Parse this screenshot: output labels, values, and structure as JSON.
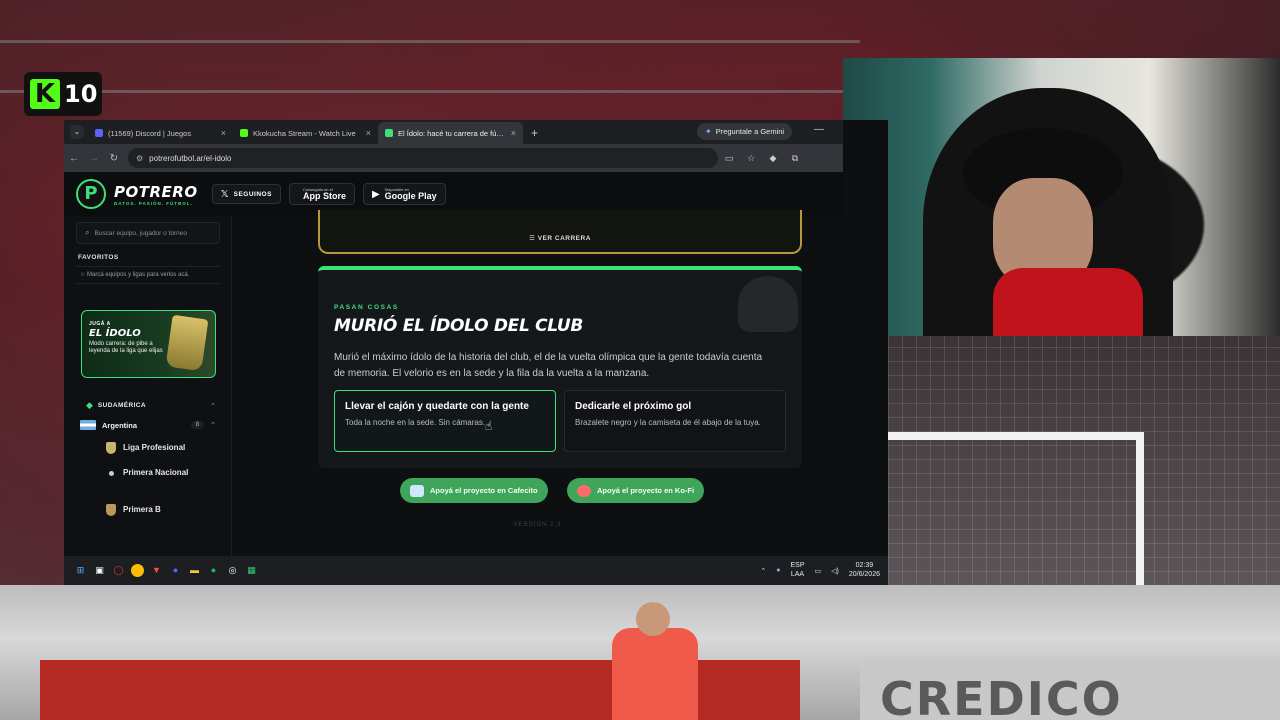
{
  "stream": {
    "viewer_count": "10",
    "ad_text": "CREDICO"
  },
  "browser": {
    "tabs": [
      {
        "label": "(11569) Discord | Juegos",
        "favicon_color": "#5865f2"
      },
      {
        "label": "Kkokucha Stream - Watch Live",
        "favicon_color": "#53fc18"
      },
      {
        "label": "El Ídolo: hacé tu carrera de fútbol",
        "favicon_color": "#3de07a",
        "active": true
      }
    ],
    "gemini_label": "Preguntale a Gemini",
    "url": "potrerofutbol.ar/el-idolo"
  },
  "site": {
    "brand_name": "POTRERO",
    "brand_tag": "DATOS. PASIÓN. FÚTBOL.",
    "follow_label": "SEGUINOS",
    "app_store_small": "Conseguilo en el",
    "app_store_big": "App Store",
    "google_play_small": "Disponible en",
    "google_play_big": "Google Play"
  },
  "sidebar": {
    "search_placeholder": "Buscar equipo, jugador o torneo",
    "favorites_title": "FAVORITOS",
    "favorites_hint": "Marcá equipos y ligas para verlos acá.",
    "promo": {
      "kicker": "JUGÁ A",
      "title": "EL ÍDOLO",
      "desc": "Modo carrera: de pibe a leyenda de la liga que elijas"
    },
    "region": "SUDAMÉRICA",
    "country": "Argentina",
    "country_count": "8",
    "leagues": [
      {
        "label": "Liga Profesional"
      },
      {
        "label": "Primera Nacional"
      },
      {
        "label": "Primera B"
      }
    ]
  },
  "main": {
    "career_link": "VER CARRERA",
    "event": {
      "kicker": "PASAN COSAS",
      "title": "MURIÓ EL ÍDOLO DEL CLUB",
      "body": "Murió el máximo ídolo de la historia del club, el de la vuelta olímpica que la gente todavía cuenta de memoria. El velorio es en la sede y la fila da la vuelta a la manzana.",
      "choices": [
        {
          "title": "Llevar el cajón y quedarte con la gente",
          "desc": "Toda la noche en la sede. Sin cámaras."
        },
        {
          "title": "Dedicarle el próximo gol",
          "desc": "Brazalete negro y la camiseta de él abajo de la tuya."
        }
      ]
    },
    "support_cafecito": "Apoyá el proyecto en Cafecito",
    "support_kofi": "Apoyá el proyecto en Ko-Fi",
    "version": "VERSIÓN 2.3"
  },
  "taskbar": {
    "lang": "ESP",
    "lang_sub": "LAA",
    "time": "02:39",
    "date": "20/6/2026"
  },
  "colors": {
    "accent": "#3de07a",
    "gold": "#b8983a",
    "kick": "#53fc18"
  }
}
